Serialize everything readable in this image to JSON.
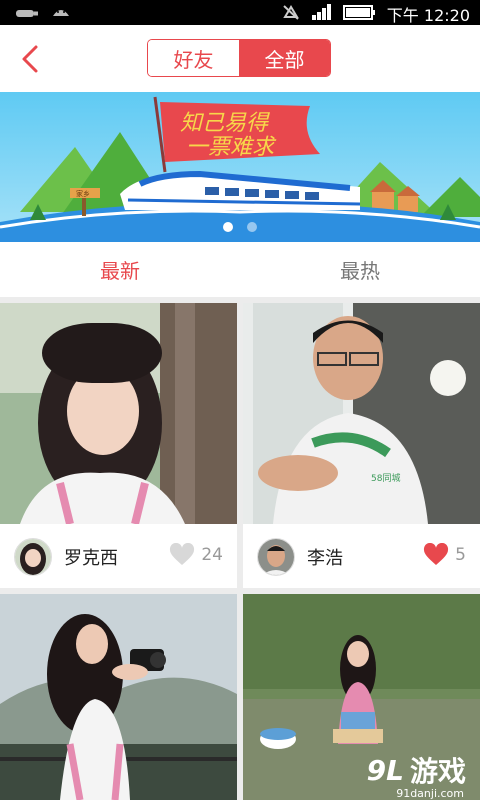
{
  "status_bar": {
    "time": "下午 12:20",
    "icons": [
      "usb-icon",
      "android-icon",
      "silent-icon",
      "signal-icon",
      "battery-icon"
    ]
  },
  "header": {
    "back_icon": "chevron-left-icon",
    "segments": [
      {
        "label": "好友",
        "active": false
      },
      {
        "label": "全部",
        "active": true
      }
    ]
  },
  "banner": {
    "flag_line1": "知己易得",
    "flag_line2": "一票难求",
    "signpost": "家乡",
    "carousel_dots": 2,
    "carousel_active": 0
  },
  "tabs": [
    {
      "label": "最新",
      "active": true
    },
    {
      "label": "最热",
      "active": false
    }
  ],
  "feed": [
    {
      "user": "罗克西",
      "likes": "24",
      "liked": false
    },
    {
      "user": "李浩",
      "likes": "5",
      "liked": true
    },
    {
      "user": "",
      "likes": "",
      "liked": false
    },
    {
      "user": "",
      "likes": "",
      "liked": false
    }
  ],
  "shirt_text": "58同城",
  "watermark": {
    "logo": "9L",
    "text": "游戏",
    "url": "91danji.com"
  },
  "colors": {
    "accent": "#e8484d",
    "sky": "#4ec2f0",
    "grass": "#66c14e"
  }
}
